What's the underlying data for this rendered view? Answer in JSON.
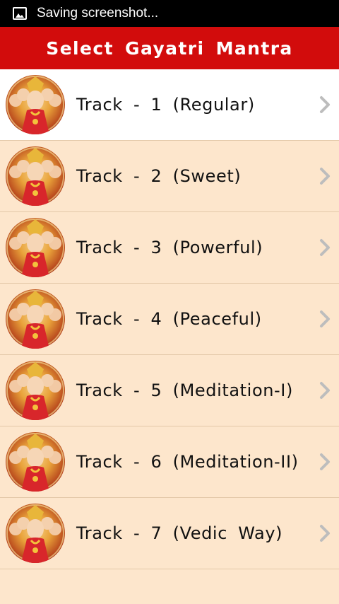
{
  "status_bar": {
    "notification_icon": "image-icon",
    "text": "Saving screenshot..."
  },
  "header": {
    "title": "Select  Gayatri  Mantra"
  },
  "colors": {
    "header_red": "#d20c0c",
    "list_bg": "#fde6cc",
    "selected_bg": "#ffffff",
    "chevron_gray": "#bdbdbd"
  },
  "tracks": [
    {
      "label": "Track - 1 (Regular)",
      "thumbnail": "gayatri-image",
      "selected": true
    },
    {
      "label": "Track - 2 (Sweet)",
      "thumbnail": "gayatri-image",
      "selected": false
    },
    {
      "label": "Track - 3 (Powerful)",
      "thumbnail": "gayatri-image",
      "selected": false
    },
    {
      "label": "Track - 4 (Peaceful)",
      "thumbnail": "gayatri-image",
      "selected": false
    },
    {
      "label": "Track - 5 (Meditation-I)",
      "thumbnail": "gayatri-image",
      "selected": false
    },
    {
      "label": "Track - 6 (Meditation-II)",
      "thumbnail": "gayatri-image",
      "selected": false
    },
    {
      "label": "Track - 7 (Vedic Way)",
      "thumbnail": "gayatri-image",
      "selected": false
    }
  ]
}
